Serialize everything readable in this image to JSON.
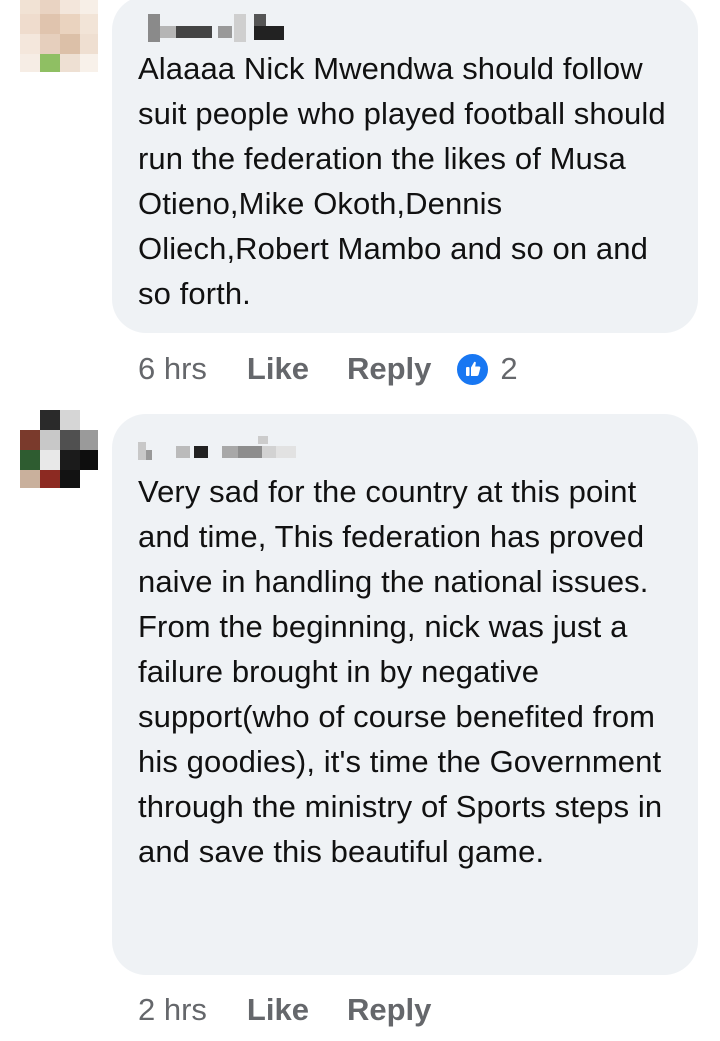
{
  "comments": [
    {
      "text": "Alaaaa Nick Mwendwa should follow suit people who played football should run the federation the likes of Musa Otieno,Mike Okoth,Dennis Oliech,Robert Mambo and so on and so forth.",
      "time": "6 hrs",
      "like_label": "Like",
      "reply_label": "Reply",
      "reaction_count": "2",
      "reaction_icon": "thumbs-up-icon",
      "reaction_color": "#1877f2"
    },
    {
      "text": "Very sad for the country at this point and time, This federation has proved naive in handling the national issues. From the beginning, nick was just a failure brought in by negative support(who of course benefited from his goodies), it's time the Government through the ministry of Sports steps in and save this beautiful game.",
      "time": "2 hrs",
      "like_label": "Like",
      "reply_label": "Reply"
    }
  ],
  "colors": {
    "bubble": "#eff2f5",
    "meta_text": "#65676b",
    "body_text": "#050505",
    "like_blue": "#1877f2"
  }
}
